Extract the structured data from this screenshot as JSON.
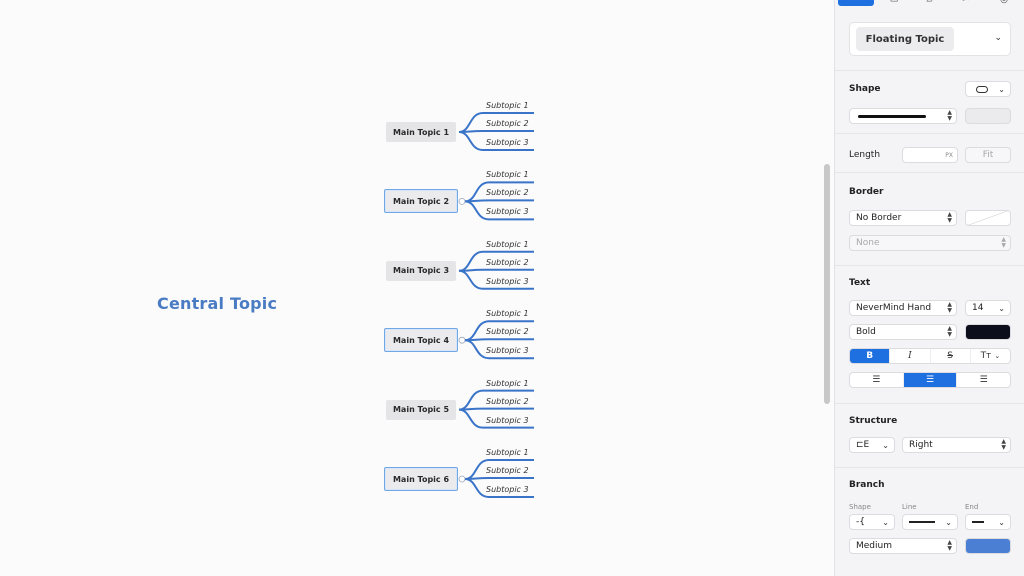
{
  "canvas": {
    "central_topic": "Central Topic",
    "main_topics": [
      {
        "label": "Main Topic 1",
        "selected": false,
        "subtopics": [
          "Subtopic 1",
          "Subtopic 2",
          "Subtopic 3"
        ]
      },
      {
        "label": "Main Topic 2",
        "selected": true,
        "subtopics": [
          "Subtopic 1",
          "Subtopic 2",
          "Subtopic 3"
        ]
      },
      {
        "label": "Main Topic 3",
        "selected": false,
        "subtopics": [
          "Subtopic 1",
          "Subtopic 2",
          "Subtopic 3"
        ]
      },
      {
        "label": "Main Topic 4",
        "selected": true,
        "subtopics": [
          "Subtopic 1",
          "Subtopic 2",
          "Subtopic 3"
        ]
      },
      {
        "label": "Main Topic 5",
        "selected": false,
        "subtopics": [
          "Subtopic 1",
          "Subtopic 2",
          "Subtopic 3"
        ]
      },
      {
        "label": "Main Topic 6",
        "selected": true,
        "subtopics": [
          "Subtopic 1",
          "Subtopic 2",
          "Subtopic 3"
        ]
      }
    ],
    "branch_color": "#3a74c9"
  },
  "panel": {
    "style_name": "Floating Topic",
    "shape": {
      "title": "Shape",
      "shape_icon": "rounded-rect-icon"
    },
    "length": {
      "label": "Length",
      "unit": "PX",
      "fit_label": "Fit"
    },
    "border": {
      "title": "Border",
      "border_value": "No Border",
      "secondary_value": "None"
    },
    "text": {
      "title": "Text",
      "font": "NeverMind Hand",
      "size": "14",
      "weight": "Bold",
      "color": "#0d0e1c",
      "bold_label": "B",
      "italic_label": "I",
      "strike_label": "S",
      "case_label": "Tт"
    },
    "structure": {
      "title": "Structure",
      "direction": "Right"
    },
    "branch": {
      "title": "Branch",
      "shape_label": "Shape",
      "line_label": "Line",
      "end_label": "End",
      "thickness": "Medium",
      "color": "#4a7fd4"
    },
    "accent_color": "#1e6fe0"
  }
}
